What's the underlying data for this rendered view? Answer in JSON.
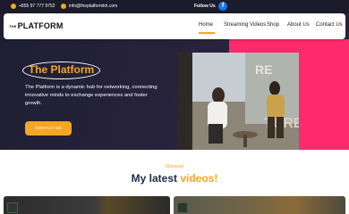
{
  "topbar": {
    "phone": "+855 97 777 9752",
    "email": "info@theplatformkh.com",
    "follow_label": "Follow Us",
    "facebook_glyph": "f"
  },
  "nav": {
    "logo_small": "THE",
    "logo_main": "PLATFORM",
    "items": [
      {
        "label": "Home",
        "active": true
      },
      {
        "label": "Streaming Videos",
        "active": false
      },
      {
        "label": "Shop",
        "active": false
      },
      {
        "label": "About Us",
        "active": false
      },
      {
        "label": "Contact Us",
        "active": false
      }
    ]
  },
  "hero": {
    "title": "The Platform",
    "description": "The Platform is a dynamic hub for networking, connecting innovative minds to exchange experiences and foster growth.",
    "cta_label": "CONTACT ME"
  },
  "section": {
    "kicker": "Showreel",
    "title_main": "My latest",
    "title_accent": "videos!"
  },
  "colors": {
    "accent": "#f5a623",
    "hero_bg": "#26223a",
    "pink": "#ff2a6d",
    "dark_text": "#1f2a44",
    "facebook": "#1877f2"
  }
}
